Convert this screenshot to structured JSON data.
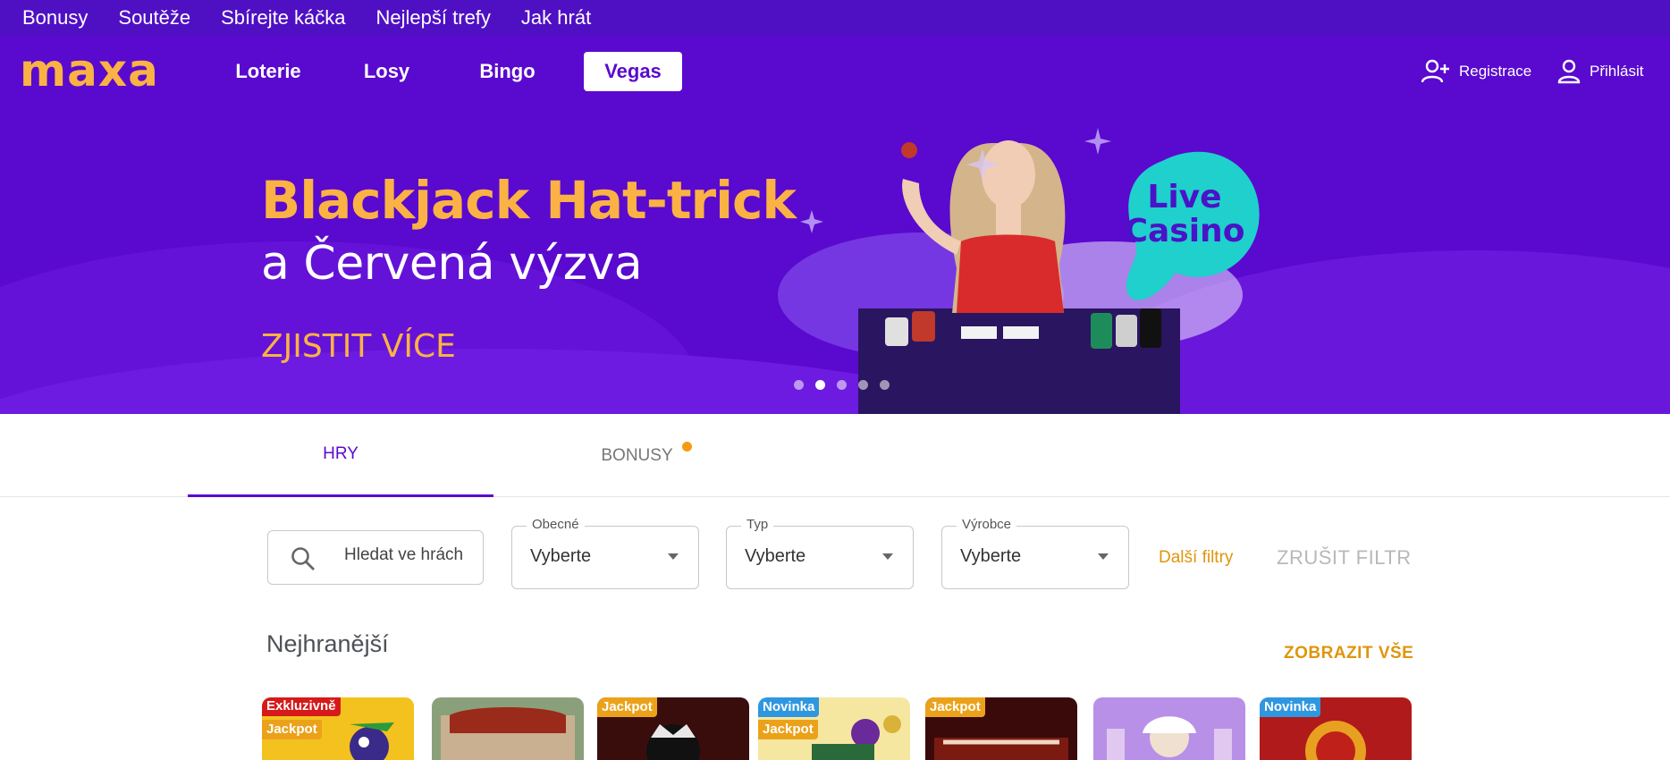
{
  "top_links": [
    "Bonusy",
    "Soutěže",
    "Sbírejte káčka",
    "Nejlepší trefy",
    "Jak hrát"
  ],
  "nav": {
    "logo": "maxa",
    "items": [
      "Loterie",
      "Losy",
      "Bingo",
      "Vegas"
    ],
    "active": "Vegas",
    "register_label": "Registrace",
    "login_label": "Přihlásit"
  },
  "hero": {
    "title": "Blackjack Hat-trick",
    "subtitle": "a Červená výzva",
    "cta": "ZJISTIT VÍCE",
    "badge_line1": "Live",
    "badge_line2": "Casino",
    "slide_count": 5,
    "active_slide": 2
  },
  "tabs": {
    "games": "HRY",
    "bonuses": "BONUSY"
  },
  "filters": {
    "search_placeholder": "Hledat ve hrách",
    "general_label": "Obecné",
    "general_value": "Vyberte",
    "type_label": "Typ",
    "type_value": "Vyberte",
    "maker_label": "Výrobce",
    "maker_value": "Vyberte",
    "more_filters": "Další filtry",
    "clear_filter": "ZRUŠIT FILTR"
  },
  "section": {
    "title": "Nejhranější",
    "show_all": "ZOBRAZIT VŠE"
  },
  "games": [
    {
      "badges": [
        "Exkluzivně",
        "Jackpot"
      ]
    },
    {
      "badges": []
    },
    {
      "badges": [
        "Jackpot"
      ]
    },
    {
      "badges": [
        "Novinka",
        "Jackpot"
      ]
    },
    {
      "badges": [
        "Jackpot"
      ]
    },
    {
      "badges": []
    },
    {
      "badges": [
        "Novinka"
      ]
    }
  ],
  "colors": {
    "brand_purple": "#5a09cf",
    "accent_orange": "#fbb244",
    "teal": "#1fd0cc"
  }
}
